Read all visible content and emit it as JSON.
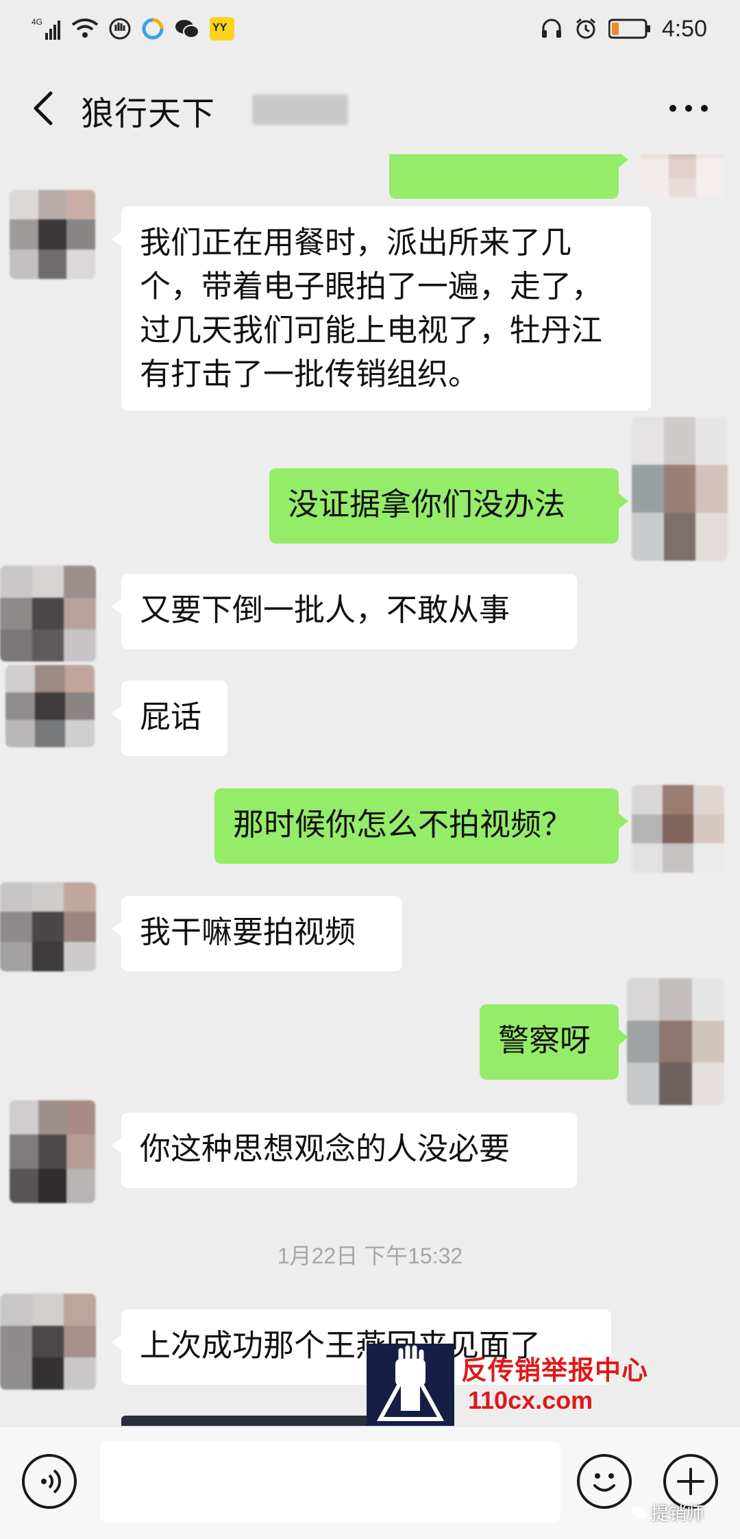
{
  "status_bar": {
    "network": "4G",
    "app_badge": "YY",
    "time": "4:50",
    "battery_color": "#f08a24"
  },
  "header": {
    "title": "狼行天下",
    "back_icon": "chevron-left-icon",
    "more_icon": "more-dots-icon"
  },
  "messages": [
    {
      "side": "in",
      "text": "我们正在用餐时，派出所来了几个，带着电子眼拍了一遍，走了，过几天我们可能上电视了，牡丹江有打击了一批传销组织。"
    },
    {
      "side": "out",
      "text": "没证据拿你们没办法"
    },
    {
      "side": "in",
      "text": "又要下倒一批人，不敢从事"
    },
    {
      "side": "in",
      "text": "屁话"
    },
    {
      "side": "out",
      "text": "那时候你怎么不拍视频？"
    },
    {
      "side": "in",
      "text": "我干嘛要拍视频"
    },
    {
      "side": "out",
      "text": "警察呀"
    },
    {
      "side": "in",
      "text": "你这种思想观念的人没必要"
    },
    {
      "side": "in",
      "text": "上次成功那个王燕回来见面了"
    }
  ],
  "timestamp": "1月22日 下午15:32",
  "input_bar": {
    "voice_icon": "voice-icon",
    "emoji_icon": "emoji-icon",
    "plus_icon": "plus-icon",
    "input_value": ""
  },
  "watermark": {
    "line1": "反传销举报中心",
    "line2": "110cx.com",
    "account": "提销师"
  },
  "colors": {
    "background": "#ededed",
    "bubble_out": "#95ec69",
    "bubble_in": "#ffffff",
    "watermark_red": "#e01818"
  }
}
